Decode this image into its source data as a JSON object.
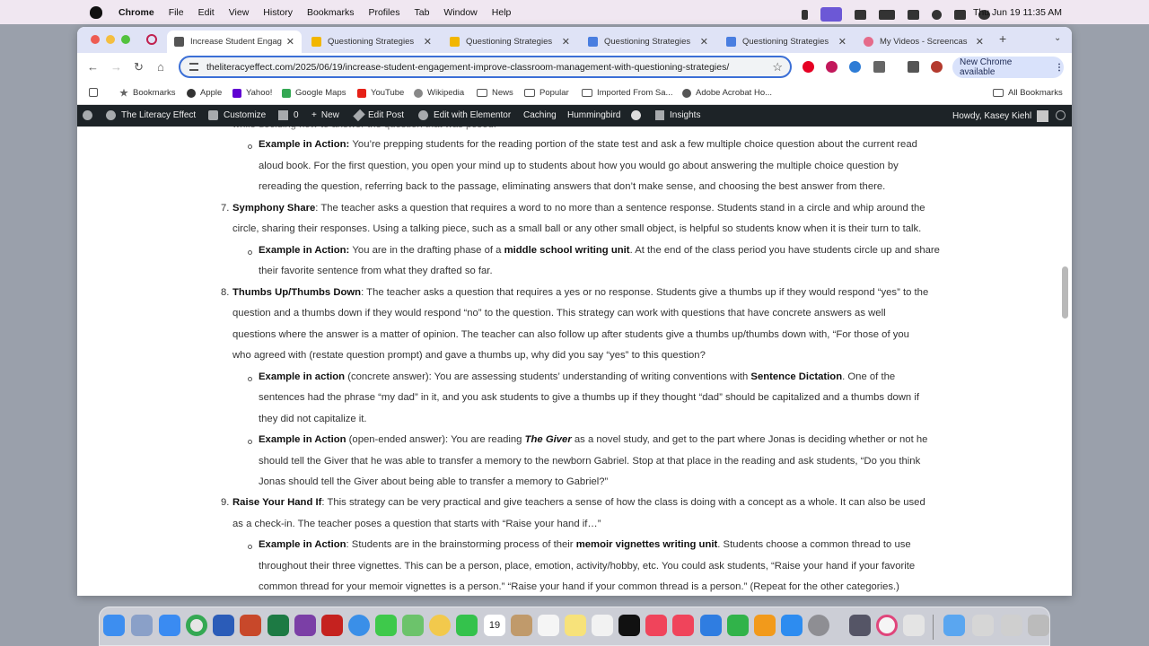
{
  "menubar": {
    "app": "Chrome",
    "items": [
      "File",
      "Edit",
      "View",
      "History",
      "Bookmarks",
      "Profiles",
      "Tab",
      "Window",
      "Help"
    ],
    "clock": "Thu Jun 19  11:35 AM"
  },
  "tabs": [
    {
      "title": "Increase Student Engag",
      "favicon_color": "#555",
      "active": true
    },
    {
      "title": "Questioning Strategies",
      "favicon_color": "#f2b600",
      "active": false
    },
    {
      "title": "Questioning Strategies",
      "favicon_color": "#f2b600",
      "active": false
    },
    {
      "title": "Questioning Strategies",
      "favicon_color": "#4a7ee0",
      "active": false
    },
    {
      "title": "Questioning Strategies",
      "favicon_color": "#4a7ee0",
      "active": false
    },
    {
      "title": "My Videos - Screencas",
      "favicon_color": "#e56b8a",
      "active": false
    }
  ],
  "toolbar": {
    "url": "theliteracyeffect.com/2025/06/19/increase-student-engagement-improve-classroom-management-with-questioning-strategies/",
    "update_label": "New Chrome available"
  },
  "bookmarks": {
    "items": [
      "Bookmarks",
      "Apple",
      "Yahoo!",
      "Google Maps",
      "YouTube",
      "Wikipedia",
      "News",
      "Popular",
      "Imported From Sa...",
      "Adobe Acrobat Ho..."
    ],
    "all_label": "All Bookmarks"
  },
  "wpbar": {
    "site": "The Literacy Effect",
    "customize": "Customize",
    "comments": "0",
    "new": "New",
    "edit_post": "Edit Post",
    "elementor": "Edit with Elementor",
    "caching": "Caching",
    "hummingbird": "Hummingbird",
    "insights": "Insights",
    "howdy": "Howdy, Kasey Kiehl"
  },
  "article": {
    "partial_top": "while deciding how to answer the question that was posed.",
    "lines": {
      "l1a": "Example in Action: ",
      "l1b": "You’re prepping students for the reading portion of the state test and ask a few multiple choice question about the current read",
      "l2": "aloud book. For the first question, you open your mind up to students about how you would go about answering the multiple choice question by",
      "l3": "rereading the question, referring back to the passage, eliminating answers that don’t make sense, and choosing the best answer from there.",
      "n7": "7.",
      "s7a": "Symphony Share",
      "s7b": ": The teacher asks a question that requires a word to no more than a sentence response. Students stand in a circle and whip around the",
      "s7c": "circle, sharing their responses. Using a talking piece, such as a small ball or any other small object, is helpful so students know when it is their turn to talk.",
      "e7a": "Example in Action: ",
      "e7b": "You are in the drafting phase of a ",
      "e7c": "middle school writing unit",
      "e7d": ". At the end of the class period you have students circle up and share",
      "e7e": "their favorite sentence from what they drafted so far.",
      "n8": "8.",
      "s8a": "Thumbs Up/Thumbs Down",
      "s8b": ": The teacher asks a question that requires a yes or no response. Students give a thumbs up if they would respond “yes” to the",
      "s8c": "question and a thumbs down if they would respond “no” to the question. This strategy can work with questions that have concrete answers as well",
      "s8d": "questions where the answer is a matter of opinion. The teacher can also follow up after students give a thumbs up/thumbs down with, “For those of you",
      "s8e": "who agreed with (restate question prompt) and gave a thumbs up, why did you say “yes” to this question?",
      "e8a": "Example in action",
      "e8b": " (concrete answer): You are assessing students’ understanding of writing conventions with ",
      "e8c": "Sentence Dictation",
      "e8d": ". One of the",
      "e8e": "sentences had the phrase “my dad” in it, and you ask students to give a thumbs up if they thought “dad” should be capitalized and a thumbs down if",
      "e8f": "they did not capitalize it.",
      "f8a": "Example in Action",
      "f8b": " (open-ended answer): You are reading ",
      "f8c": "The Giver",
      "f8d": " as a novel study, and get to the part where Jonas is deciding whether or not he",
      "f8e": "should tell the Giver that he was able to transfer a memory to the newborn Gabriel. Stop at that place in the reading and ask students, “Do you think",
      "f8f": "Jonas should tell the Giver about being able to transfer a memory to Gabriel?”",
      "n9": "9.",
      "s9a": "Raise Your Hand If",
      "s9b": ": This strategy can be very practical and give teachers a sense of how the class is doing with a concept as a whole. It can also be used",
      "s9c": "as a check-in. The teacher poses a question that starts with “Raise your hand if…”",
      "e9a": "Example in Action",
      "e9b": ": Students are in the brainstorming process of their ",
      "e9c": "memoir vignettes writing unit",
      "e9d": ". Students choose a common thread to use",
      "e9e": "throughout their three vignettes. This can be a person, place, emotion, activity/hobby, etc. You could ask students, “Raise your hand if your favorite",
      "e9f": "common thread for your memoir vignettes is a person.” “Raise your hand if your common thread is a person.” (Repeat for the other categories.)"
    }
  },
  "dock": {
    "apps": [
      "Finder",
      "Launchpad",
      "Mail",
      "Chrome",
      "Word",
      "PowerPoint",
      "Excel",
      "OneNote",
      "Acrobat",
      "Safari",
      "Messages",
      "Maps",
      "Photos",
      "FaceTime",
      "Calendar",
      "Contacts",
      "Reminders",
      "Notes",
      "Freeform",
      "TV",
      "Music",
      "News",
      "Keynote",
      "Numbers",
      "Pages",
      "App Store",
      "System Settings"
    ],
    "calendar_day": "19"
  }
}
